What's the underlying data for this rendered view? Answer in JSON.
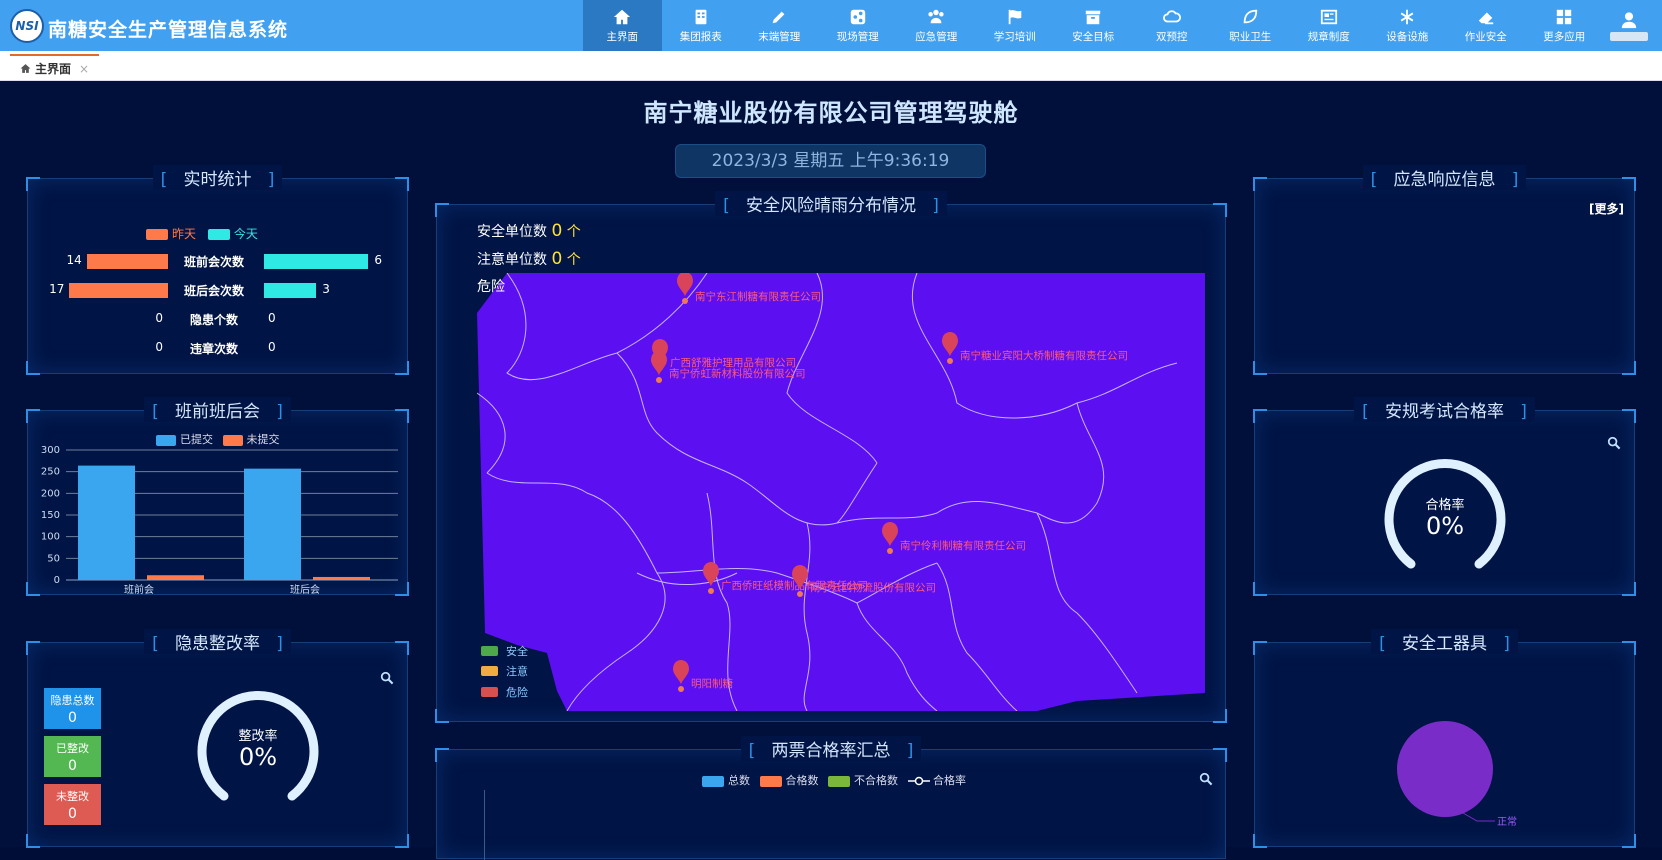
{
  "app": {
    "logo_text": "NSI",
    "title": "南糖安全生产管理信息系统"
  },
  "nav": [
    {
      "label": "主界面",
      "icon": "home-icon"
    },
    {
      "label": "集团报表",
      "icon": "report-icon"
    },
    {
      "label": "末端管理",
      "icon": "pencil-icon"
    },
    {
      "label": "现场管理",
      "icon": "share-icon"
    },
    {
      "label": "应急管理",
      "icon": "users-icon"
    },
    {
      "label": "学习培训",
      "icon": "flag-icon"
    },
    {
      "label": "安全目标",
      "icon": "archive-icon"
    },
    {
      "label": "双预控",
      "icon": "cloud-icon"
    },
    {
      "label": "职业卫生",
      "icon": "leaf-icon"
    },
    {
      "label": "规章制度",
      "icon": "newspaper-icon"
    },
    {
      "label": "设备设施",
      "icon": "asterisk-icon"
    },
    {
      "label": "作业安全",
      "icon": "eraser-icon"
    },
    {
      "label": "更多应用",
      "icon": "grid-icon"
    }
  ],
  "tab": {
    "label": "主界面"
  },
  "dashboard": {
    "title": "南宁糖业股份有限公司管理驾驶舱",
    "datetime": "2023/3/3 星期五 上午9:36:19"
  },
  "realtime": {
    "title": "实时统计",
    "legend": {
      "yesterday": "昨天",
      "today": "今天"
    },
    "colors": {
      "yesterday": "#ff7a4a",
      "today": "#2ee9e4"
    },
    "rows": [
      {
        "label": "班前会次数",
        "yesterday": 14,
        "today": 6
      },
      {
        "label": "班后会次数",
        "yesterday": 17,
        "today": 3
      },
      {
        "label": "隐患个数",
        "yesterday": 0,
        "today": 0
      },
      {
        "label": "违章次数",
        "yesterday": 0,
        "today": 0
      }
    ]
  },
  "meeting": {
    "title": "班前班后会",
    "legend": {
      "submitted": "已提交",
      "unsubmitted": "未提交"
    },
    "chart_data": {
      "type": "bar",
      "categories": [
        "班前会",
        "班后会"
      ],
      "series": [
        {
          "name": "已提交",
          "values": [
            264,
            257
          ],
          "color": "#3aa6f0"
        },
        {
          "name": "未提交",
          "values": [
            11,
            7
          ],
          "color": "#ff7a4a"
        }
      ],
      "ylim": [
        0,
        300
      ],
      "yticks": [
        0,
        50,
        100,
        150,
        200,
        250,
        300
      ]
    }
  },
  "hazard": {
    "title": "隐患整改率",
    "kpis": [
      {
        "label": "隐患总数",
        "value": "0",
        "color": "#1f93e9"
      },
      {
        "label": "已整改",
        "value": "0",
        "color": "#53b852"
      },
      {
        "label": "未整改",
        "value": "0",
        "color": "#dd5b53"
      }
    ],
    "gauge": {
      "label": "整改率",
      "value": "0%"
    }
  },
  "risk_map": {
    "title": "安全风险晴雨分布情况",
    "safe_label": "安全单位数",
    "safe_count": "0",
    "warn_label": "注意单位数",
    "warn_count": "0",
    "danger_label": "危险",
    "unit": "个",
    "legend": [
      {
        "label": "安全",
        "color": "#4ea94b"
      },
      {
        "label": "注意",
        "color": "#f0ac43"
      },
      {
        "label": "危险",
        "color": "#d84f4f"
      }
    ],
    "pins": [
      "南宁东江制糖有限责任公司",
      "南宁糖业宾阳大桥制糖有限责任公司",
      "广西舒雅护理用品有限公司",
      "南宁侨虹新材料股份有限公司",
      "南宁伶利制糖有限责任公司",
      "广西侨旺纸模制品有限责任公司",
      "南宁云鸥物流股份有限公司",
      "明阳制糖"
    ]
  },
  "tickets": {
    "title": "两票合格率汇总",
    "legend": [
      {
        "label": "总数",
        "color": "#3aa6f0"
      },
      {
        "label": "合格数",
        "color": "#ff7a4a"
      },
      {
        "label": "不合格数",
        "color": "#7ab73a"
      },
      {
        "label": "合格率",
        "color": "#ffffff"
      }
    ]
  },
  "emergency": {
    "title": "应急响应信息",
    "more": "[更多]"
  },
  "exam": {
    "title": "安规考试合格率",
    "gauge": {
      "label": "合格率",
      "value": "0%"
    }
  },
  "tools": {
    "title": "安全工器具",
    "chart_data": {
      "type": "pie",
      "slices": [
        {
          "name": "正常",
          "value": 100,
          "color": "#7a2cc9"
        }
      ]
    }
  }
}
